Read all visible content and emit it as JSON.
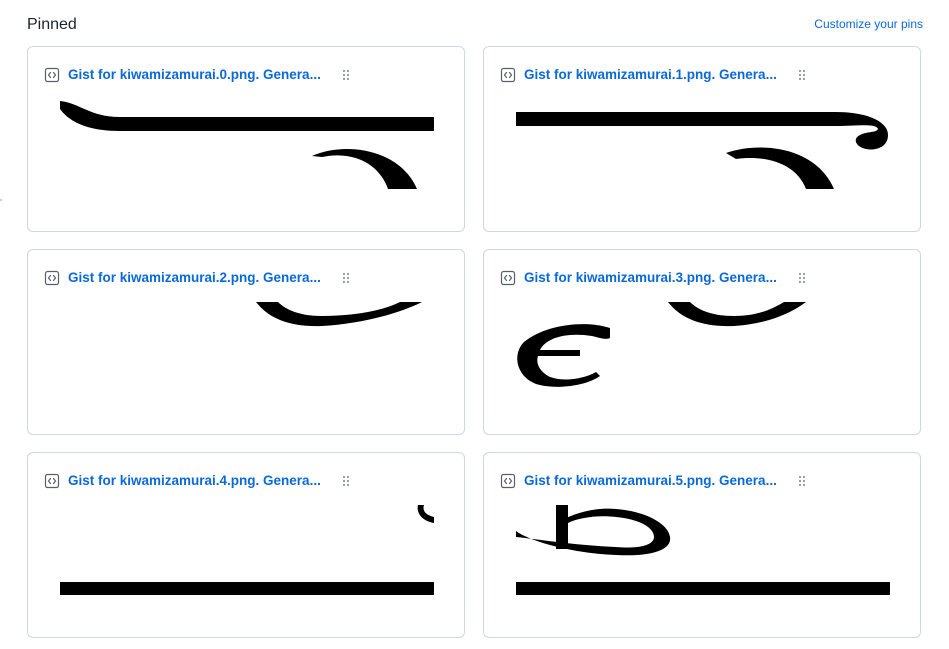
{
  "header": {
    "title": "Pinned",
    "customize_label": "Customize your pins"
  },
  "colors": {
    "link": "#0969da",
    "border": "#d0d7de",
    "text": "#1f2328",
    "muted": "#8c959f"
  },
  "pins": [
    {
      "label": "Gist for kiwamizamurai.0.png. Genera...",
      "icon": "code-square-icon",
      "grip": "grabber-icon",
      "preview": "image-preview"
    },
    {
      "label": "Gist for kiwamizamurai.1.png. Genera...",
      "icon": "code-square-icon",
      "grip": "grabber-icon",
      "preview": "image-preview"
    },
    {
      "label": "Gist for kiwamizamurai.2.png. Genera...",
      "icon": "code-square-icon",
      "grip": "grabber-icon",
      "preview": "image-preview"
    },
    {
      "label": "Gist for kiwamizamurai.3.png. Genera...",
      "icon": "code-square-icon",
      "grip": "grabber-icon",
      "preview": "image-preview"
    },
    {
      "label": "Gist for kiwamizamurai.4.png. Genera...",
      "icon": "code-square-icon",
      "grip": "grabber-icon",
      "preview": "image-preview"
    },
    {
      "label": "Gist for kiwamizamurai.5.png. Genera...",
      "icon": "code-square-icon",
      "grip": "grabber-icon",
      "preview": "image-preview"
    }
  ]
}
